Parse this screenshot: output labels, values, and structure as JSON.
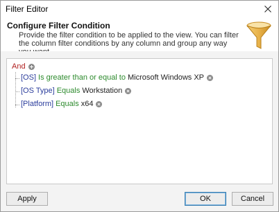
{
  "window": {
    "title": "Filter Editor"
  },
  "header": {
    "title": "Configure Filter Condition",
    "description": "Provide the filter condition to be applied to the view. You can filter the column filter conditions by any column and group any way you want."
  },
  "tree": {
    "group_operator": "And",
    "conditions": [
      {
        "field": "[OS]",
        "operator": "Is greater than or equal to",
        "value": "Microsoft Windows XP"
      },
      {
        "field": "[OS Type]",
        "operator": "Equals",
        "value": "Workstation"
      },
      {
        "field": "[Platform]",
        "operator": "Equals",
        "value": "x64"
      }
    ]
  },
  "buttons": {
    "apply": "Apply",
    "ok": "OK",
    "cancel": "Cancel"
  },
  "colors": {
    "group_operator": "#b02020",
    "field": "#2b3d9c",
    "operator": "#2c8a2c",
    "funnel": "#e8b24a"
  },
  "icons": {
    "close": "close-icon",
    "add": "add-circle-icon",
    "remove": "remove-circle-icon",
    "funnel": "funnel-icon"
  }
}
